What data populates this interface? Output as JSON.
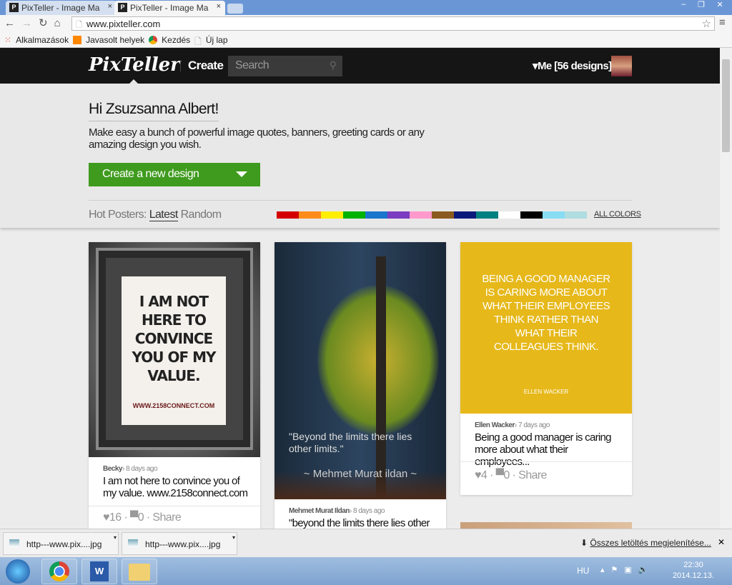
{
  "browser": {
    "tabs": [
      {
        "title": "PixTeller - Image Ma"
      },
      {
        "title": "PixTeller - Image Ma"
      }
    ],
    "url": "www.pixteller.com",
    "bookmarks": [
      "Alkalmazások",
      "Javasolt helyek",
      "Kezdés",
      "Új lap"
    ]
  },
  "nav": {
    "logo": "PixTeller",
    "create": "Create",
    "search_placeholder": "Search",
    "me": "Me",
    "designs": "[56 designs]"
  },
  "hero": {
    "greeting": "Hi Zsuzsanna Albert!",
    "subtitle": "Make easy a bunch of powerful image quotes, banners, greeting cards or any amazing design you wish.",
    "create_button": "Create a new design",
    "hot_label": "Hot Posters:",
    "latest": "Latest",
    "random": "Random",
    "all_colors": "ALL COLORS",
    "colors": [
      "#d40000",
      "#ff8c1a",
      "#ffee00",
      "#00b300",
      "#1a75cc",
      "#7a3cc0",
      "#ff99cc",
      "#8b5a1e",
      "#0a1a7a",
      "#008080",
      "#ffffff",
      "#000000",
      "#88ddf5",
      "#b0dde0"
    ]
  },
  "cards": [
    {
      "image_text": "I AM NOT HERE TO CONVINCE YOU OF MY VALUE.",
      "image_url": "WWW.2158CONNECT.COM",
      "author": "Becky",
      "age": "› 8 days ago",
      "title": "I am not here to convince you of my value. www.2158connect.com",
      "likes": "16",
      "comments": "0",
      "share": "Share"
    },
    {
      "image_text": "\"Beyond the limits there lies other limits.\"",
      "image_author": "~ Mehmet Murat ildan ~",
      "author": "Mehmet Murat Ildan",
      "age": "› 8 days ago",
      "title": "\"beyond the limits there lies other"
    },
    {
      "image_text": "BEING A GOOD MANAGER IS CARING MORE ABOUT WHAT THEIR EMPLOYEES THINK RATHER THAN WHAT THEIR COLLEAGUES THINK.",
      "image_author": "ELLEN WACKER",
      "author": "Ellen Wacker",
      "age": "› 7 days ago",
      "title": "Being a good manager is caring more about what their employees...",
      "likes": "4",
      "comments": "0",
      "share": "Share"
    }
  ],
  "downloads": {
    "items": [
      "http---www.pix....jpg",
      "http---www.pix....jpg"
    ],
    "show_all": "Összes letöltés megjelenítése..."
  },
  "taskbar": {
    "lang": "HU",
    "time": "22:30",
    "date": "2014.12.13."
  }
}
